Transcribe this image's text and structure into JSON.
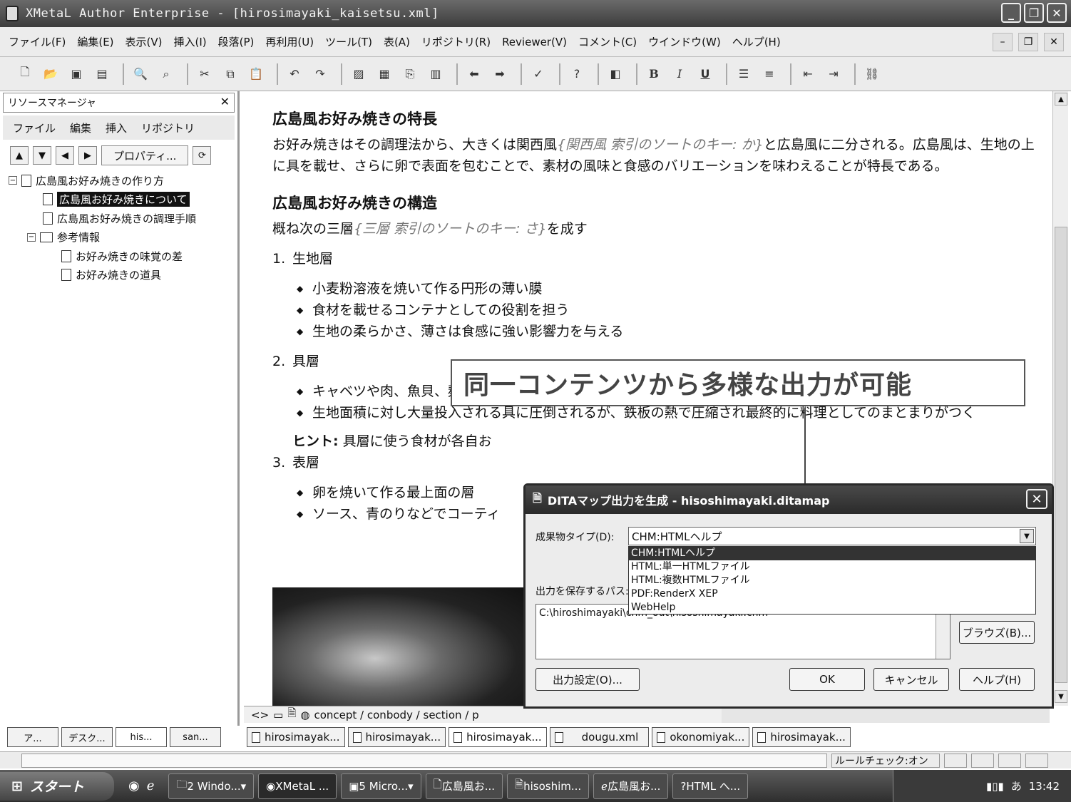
{
  "window": {
    "title": "XMetaL Author Enterprise - [hirosimayaki_kaisetsu.xml]"
  },
  "menu": [
    "ファイル(F)",
    "編集(E)",
    "表示(V)",
    "挿入(I)",
    "段落(P)",
    "再利用(U)",
    "ツール(T)",
    "表(A)",
    "リポジトリ(R)",
    "Reviewer(V)",
    "コメント(C)",
    "ウインドウ(W)",
    "ヘルプ(H)"
  ],
  "toolbar": {
    "bold": "B",
    "italic": "I",
    "underline": "U"
  },
  "resource_manager": {
    "title": "リソースマネージャ",
    "menu": [
      "ファイル",
      "編集",
      "挿入",
      "リポジトリ"
    ],
    "properties_button": "プロパティ...",
    "tree": {
      "root": "広島風お好み焼きの作り方",
      "child1": "広島風お好み焼きについて",
      "child2": "広島風お好み焼きの調理手順",
      "folder": "参考情報",
      "sub1": "お好み焼きの味覚の差",
      "sub2": "お好み焼きの道具"
    }
  },
  "document": {
    "h1": "広島風お好み焼きの特長",
    "p1_a": "お好み焼きはその調理法から、大きくは関西風",
    "p1_idx": "{関西風 索引のソートのキー: か}",
    "p1_b": "と広島風に二分される。広島風は、生地の上に具を載せ、さらに卵で表面を包むことで、素材の風味と食感のバリエーションを味わえることが特長である。",
    "h2": "広島風お好み焼きの構造",
    "p2_a": "概ね次の三層",
    "p2_idx": "{三層 索引のソートのキー: さ}",
    "p2_b": "を成す",
    "ol1": "生地層",
    "ol1_items": [
      "小麦粉溶液を焼いて作る円形の薄い膜",
      "食材を載せるコンテナとしての役割を担う",
      "生地の柔らかさ、薄さは食感に強い影響力を与える"
    ],
    "ol2": "具層",
    "ol2_items": [
      "キャベツや肉、魚貝、麺などからなる中心的な層",
      "生地面積に対し大量投入される具に圧倒されるが、鉄板の熱で圧縮され最終的に料理としてのまとまりがつく"
    ],
    "hint_label": "ヒント:",
    "hint_text": "具層に使う食材が各自お",
    "ol3": "表層",
    "ol3_items": [
      "卵を焼いて作る最上面の層",
      "ソース、青のりなどでコーティ"
    ],
    "nums": [
      "1.",
      "2.",
      "3."
    ]
  },
  "pathbar": "concept / conbody / section / p",
  "left_tabs": [
    "ア...",
    "デスク...",
    "his...",
    "san..."
  ],
  "doc_tabs": [
    "hirosimayak...",
    "hirosimayak...",
    "hirosimayak...",
    "dougu.xml",
    "okonomiyak...",
    "hirosimayak..."
  ],
  "status": {
    "rule_check": "ルールチェック:オン"
  },
  "taskbar": {
    "start": "スタート",
    "tasks": [
      "2 Windo...",
      "XMetaL ...",
      "5 Micro...",
      "広島風お...",
      "hisoshim...",
      "広島風お...",
      "HTML へ..."
    ],
    "clock": "13:42"
  },
  "callout": "同一コンテンツから多様な出力が可能",
  "dialog": {
    "title": "DITAマップ出力を生成 - hisoshimayaki.ditamap",
    "deliverable_label": "成果物タイプ(D):",
    "deliverable_value": "CHM:HTMLヘルプ",
    "options": [
      "CHM:HTMLヘルプ",
      "HTML:単一HTMLファイル",
      "HTML:複数HTMLファイル",
      "PDF:RenderX XEP",
      "WebHelp"
    ],
    "path_label": "出力を保存するパス:",
    "path_value": "C:\\hiroshimayaki\\chm_out\\hisoshimayaki.chm",
    "browse": "ブラウズ(B)...",
    "settings": "出力設定(O)...",
    "ok": "OK",
    "cancel": "キャンセル",
    "help": "ヘルプ(H)"
  }
}
